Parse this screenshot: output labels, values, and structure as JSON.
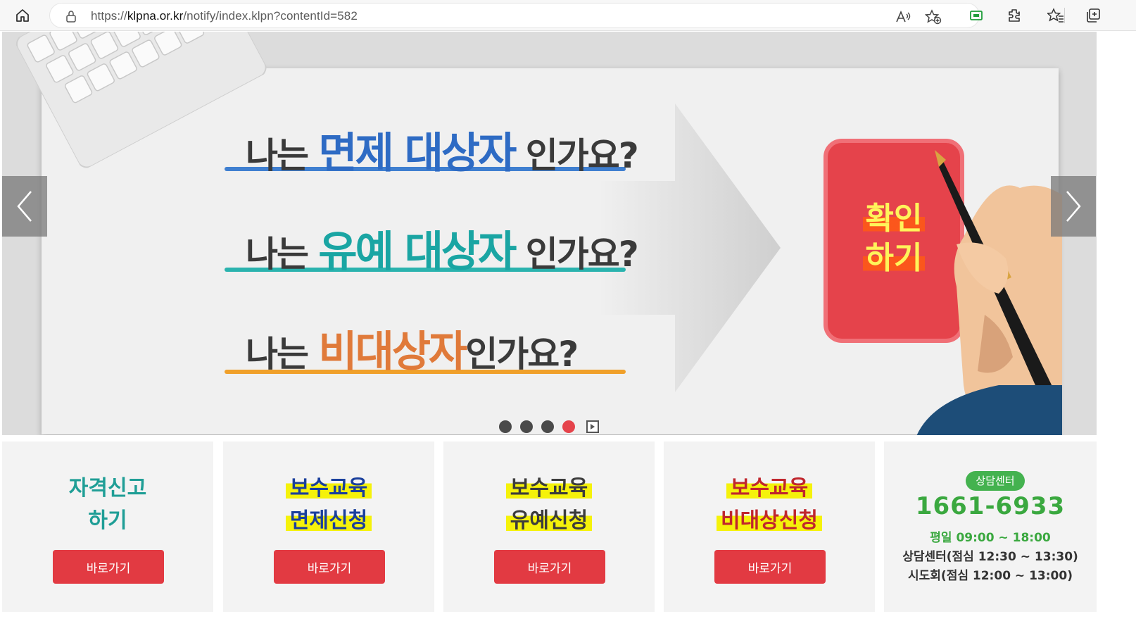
{
  "browser": {
    "url_prefix": "https://",
    "url_host": "klpna.or.kr",
    "url_path": "/notify/index.klpn?contentId=582"
  },
  "banner": {
    "lines": [
      {
        "prefix": "나는 ",
        "highlight": "면제 대상자",
        "suffix": "인가요?",
        "color": "#2e6bc4"
      },
      {
        "prefix": "나는 ",
        "highlight": "유예 대상자",
        "suffix": "인가요?",
        "color": "#1aa5a3"
      },
      {
        "prefix": "나는 ",
        "highlight": "비대상자",
        "suffix": "인가요?",
        "color": "#e07a3a"
      }
    ],
    "confirm_line1": "확인",
    "confirm_line2": "하기",
    "slide_count": 4,
    "active_slide": 4
  },
  "cards": [
    {
      "line1": "자격신고",
      "line2": "하기",
      "button": "바로가기"
    },
    {
      "line1": "보수교육",
      "line2": "면제신청",
      "button": "바로가기"
    },
    {
      "line1": "보수교육",
      "line2": "유예신청",
      "button": "바로가기"
    },
    {
      "line1": "보수교육",
      "line2": "비대상신청",
      "button": "바로가기"
    }
  ],
  "center": {
    "label": "상담센터",
    "phone": "1661-6933",
    "weekday_label": "평일",
    "weekday_hours": "09:00 ~ 18:00",
    "line2": "상담센터(점심 12:30 ~ 13:30)",
    "line3": "시도회(점심 12:00 ~ 13:00)"
  }
}
